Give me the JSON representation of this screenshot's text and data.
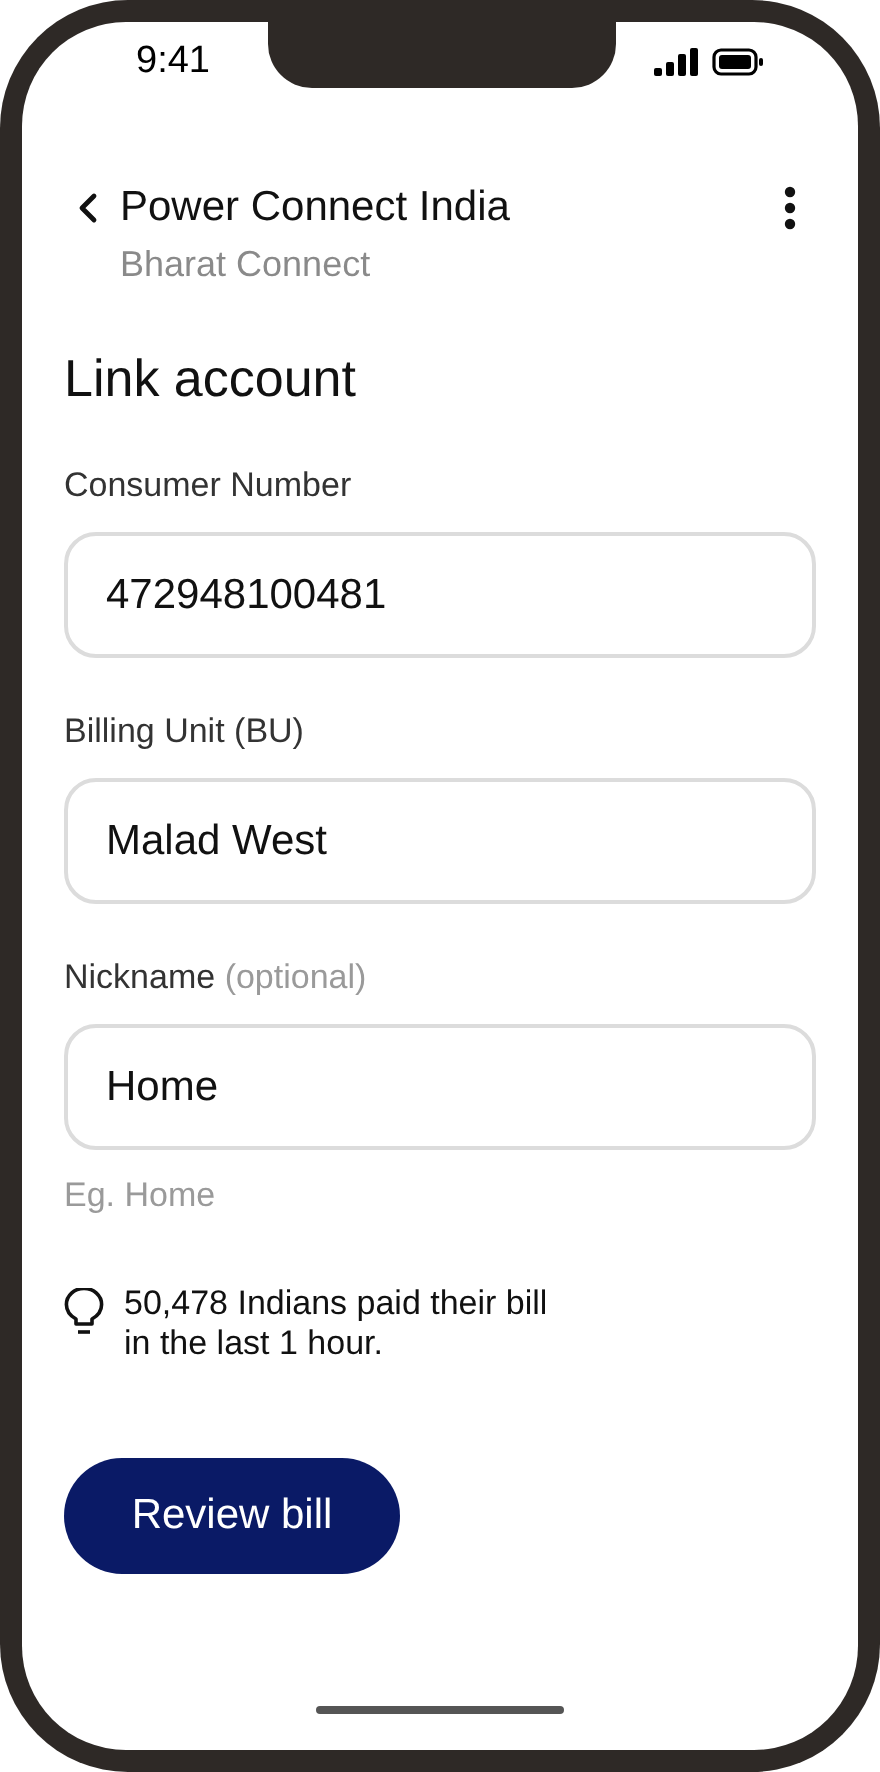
{
  "status_bar": {
    "time": "9:41"
  },
  "header": {
    "title": "Power Connect India",
    "subtitle": "Bharat Connect"
  },
  "heading": "Link account",
  "fields": [
    {
      "label": "Consumer Number",
      "value": "472948100481"
    },
    {
      "label": "Billing Unit (BU)",
      "value": "Malad West"
    },
    {
      "label": "Nickname",
      "note": "(optional)",
      "value": "Home",
      "hint": "Eg. Home"
    }
  ],
  "tip": {
    "lines": [
      "50,478 Indians paid their bill",
      "in the last 1 hour."
    ]
  },
  "primary_button": "Review bill"
}
